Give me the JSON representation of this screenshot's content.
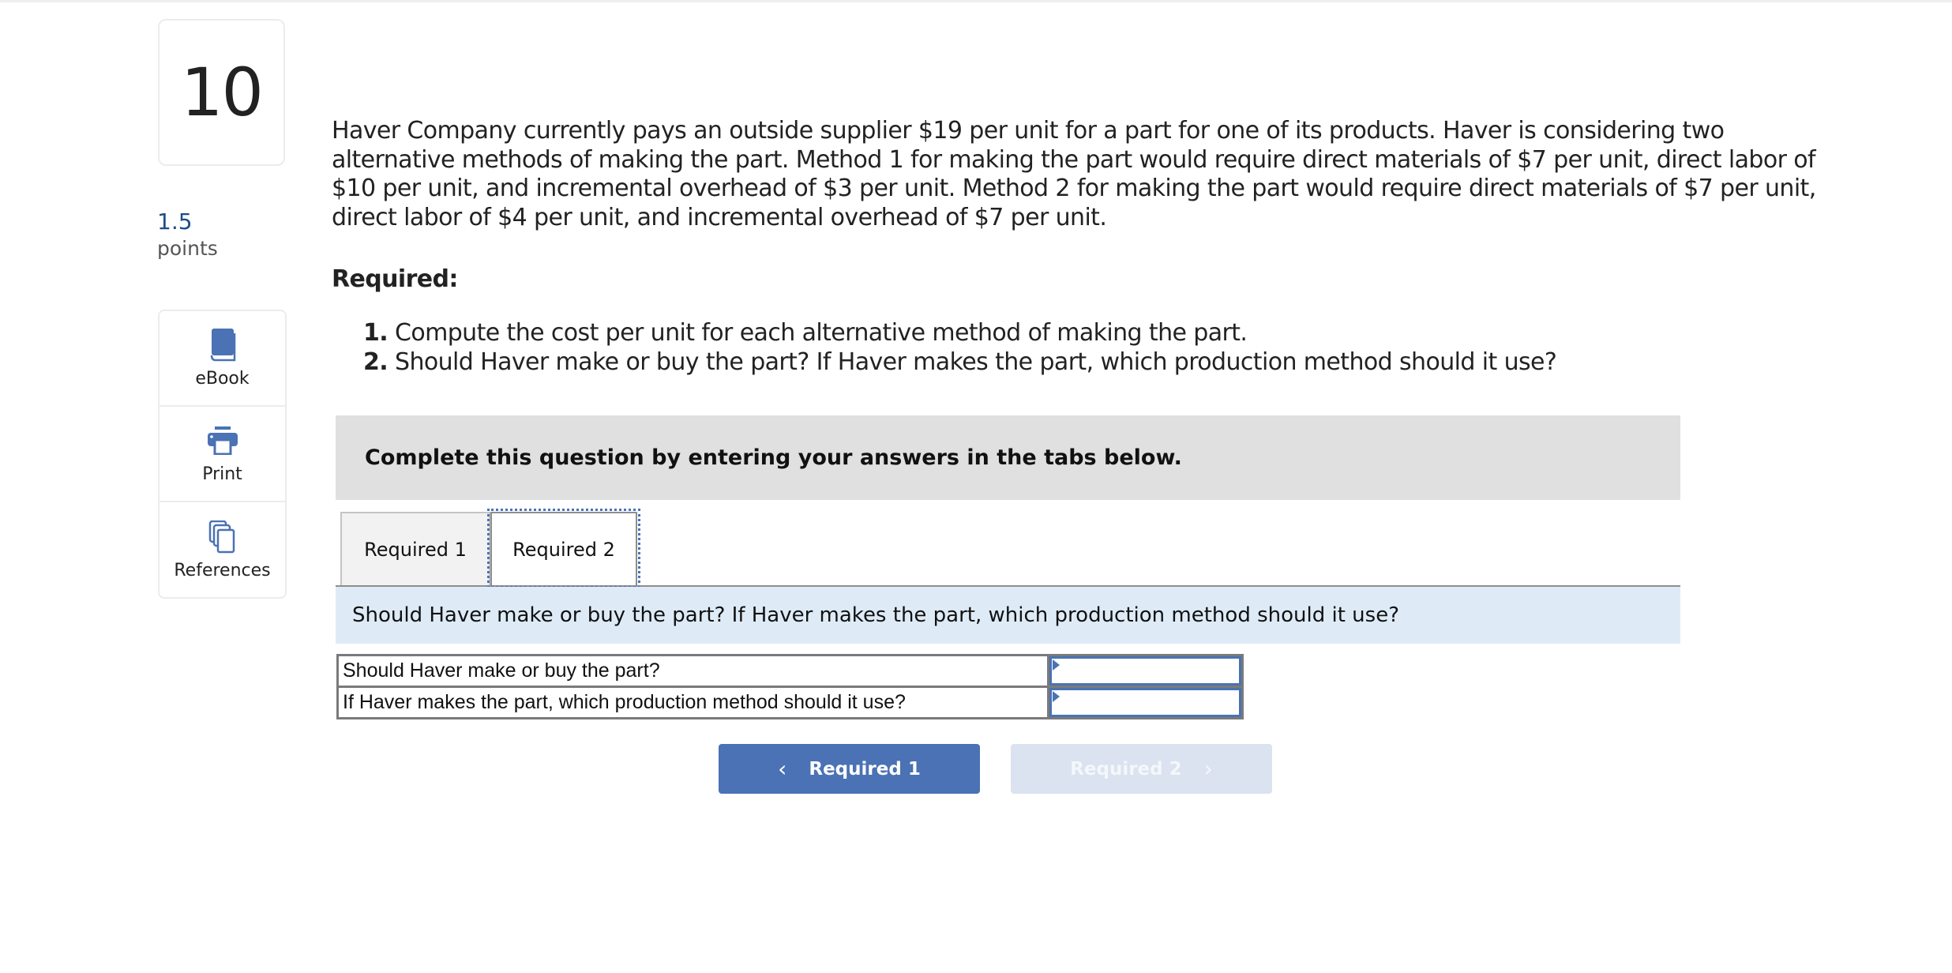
{
  "question": {
    "number": "10",
    "points_value": "1.5",
    "points_label": "points",
    "text": "Haver Company currently pays an outside supplier $19 per unit for a part for one of its products. Haver is considering two alternative methods of making the part. Method 1 for making the part would require direct materials of $7 per unit, direct labor of $10 per unit, and incremental overhead of $3 per unit. Method 2 for making the part would require direct materials of $7 per unit, direct labor of $4 per unit, and incremental overhead of $7 per unit.",
    "required_heading": "Required:",
    "required_items": [
      {
        "num": "1.",
        "text": "Compute the cost per unit for each alternative method of making the part."
      },
      {
        "num": "2.",
        "text": "Should Haver make or buy the part? If Haver makes the part, which production method should it use?"
      }
    ]
  },
  "tools": [
    {
      "label": "eBook",
      "icon": "book-icon"
    },
    {
      "label": "Print",
      "icon": "printer-icon"
    },
    {
      "label": "References",
      "icon": "documents-icon"
    }
  ],
  "instructions": "Complete this question by entering your answers in the tabs below.",
  "tabs": [
    {
      "label": "Required 1",
      "active": false
    },
    {
      "label": "Required 2",
      "active": true
    }
  ],
  "active_tab_prompt": "Should Haver make or buy the part? If Haver makes the part, which production method should it use?",
  "answer_table": {
    "rows": [
      {
        "label": "Should Haver make or buy the part?",
        "value": ""
      },
      {
        "label": "If Haver makes the part, which production method should it use?",
        "value": ""
      }
    ]
  },
  "navigation": {
    "prev_label": "Required 1",
    "next_label": "Required 2",
    "prev_icon": "chevron-left-icon",
    "next_icon": "chevron-right-icon",
    "next_disabled": true
  },
  "colors": {
    "accent": "#4a72b4",
    "points": "#1f4b8a",
    "banner_bg": "#e0e0e0",
    "prompt_bg": "#deebf7",
    "disabled_btn": "#dae3ef"
  }
}
